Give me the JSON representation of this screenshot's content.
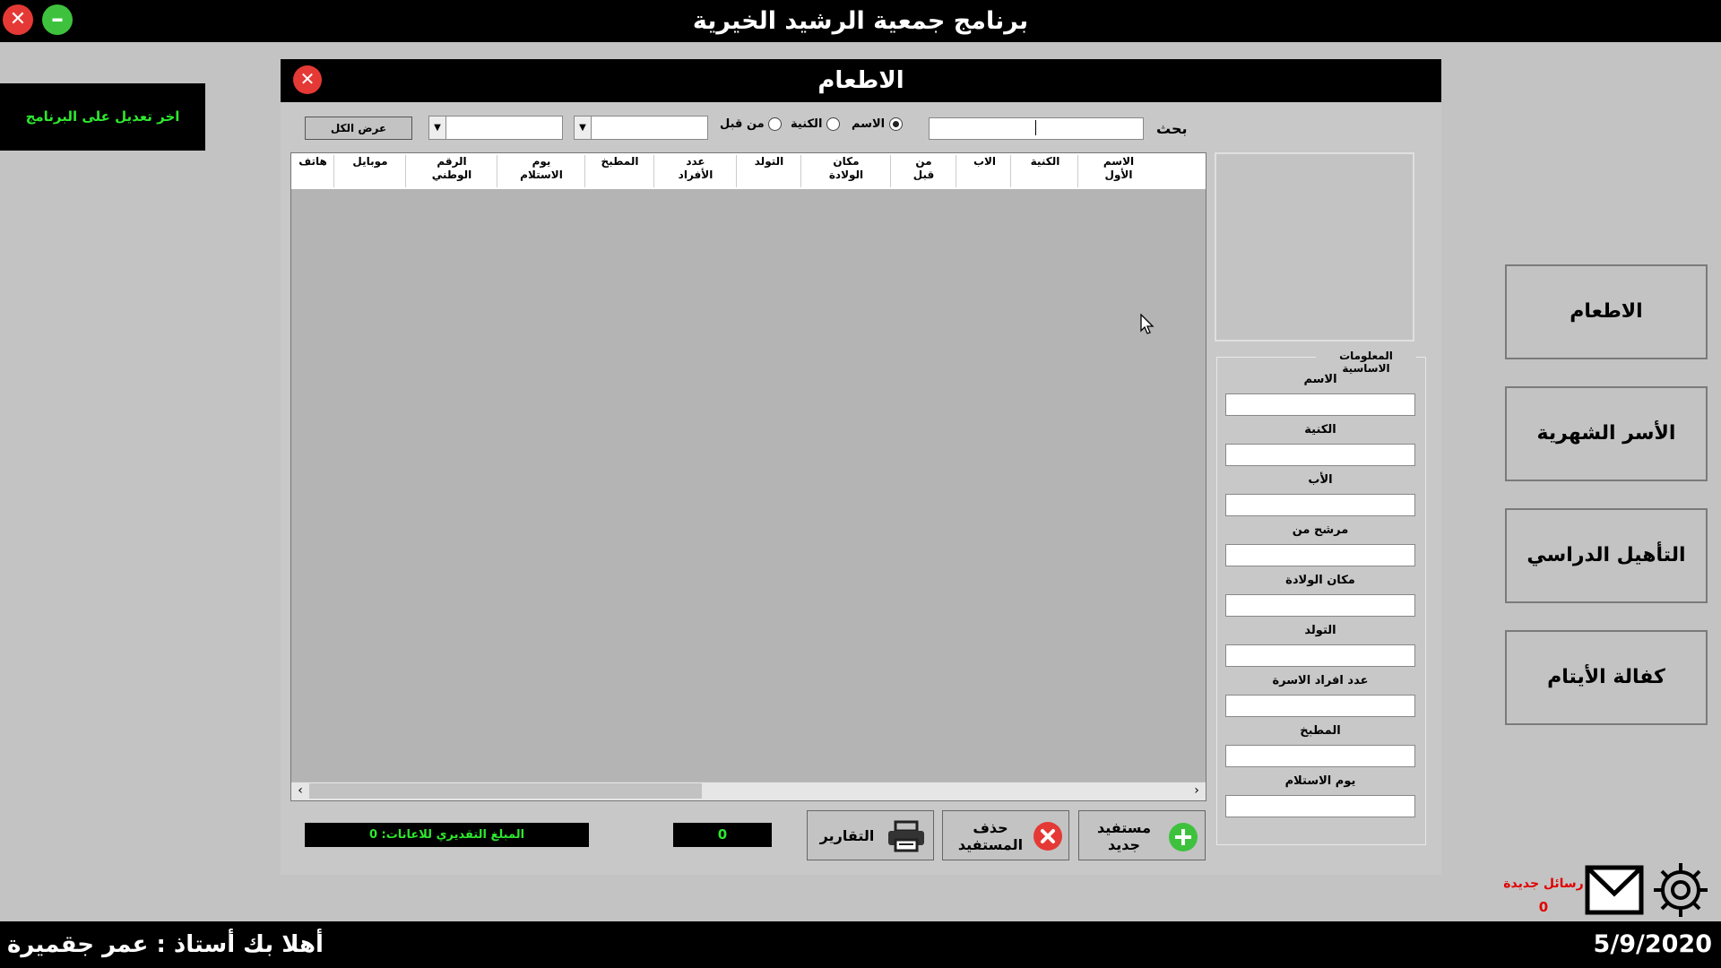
{
  "app": {
    "title": "برنامج جمعية الرشيد الخيرية",
    "close_glyph": "✕",
    "minimize_glyph": "–"
  },
  "left_note": "اخر تعديل على البرنامج",
  "side_menu": [
    {
      "label": "الاطعام"
    },
    {
      "label": "الأسر الشهرية"
    },
    {
      "label": "التأهيل الدراسي"
    },
    {
      "label": "كفالة الأيتام"
    }
  ],
  "status": {
    "welcome": "أهلا بك أستاذ : عمر جقميرة",
    "date": "5/9/2020"
  },
  "messages": {
    "label": "رسائل جديدة",
    "count": "0"
  },
  "dialog": {
    "title": "الاطعام",
    "close_glyph": "✕",
    "search": {
      "label": "بحث",
      "value": "",
      "options": [
        {
          "label": "الاسم",
          "selected": true
        },
        {
          "label": "الكنية",
          "selected": false
        },
        {
          "label": "من قبل",
          "selected": false
        }
      ],
      "combo1_value": "",
      "combo2_value": "",
      "show_all_label": "عرض الكل"
    },
    "table": {
      "columns": [
        [
          "الاسم",
          "الأول"
        ],
        [
          "الكنية",
          ""
        ],
        [
          "الاب",
          ""
        ],
        [
          "من",
          "قبل"
        ],
        [
          "مكان",
          "الولادة"
        ],
        [
          "التولد",
          ""
        ],
        [
          "عدد",
          "الأفراد"
        ],
        [
          "المطبخ",
          ""
        ],
        [
          "يوم",
          "الاستلام"
        ],
        [
          "الرقم",
          "الوطني"
        ],
        [
          "موبايل",
          ""
        ],
        [
          "هاتف",
          ""
        ]
      ],
      "rows": []
    },
    "info": {
      "legend": "المعلومات الاساسية",
      "fields": [
        {
          "label": "الاسم",
          "value": ""
        },
        {
          "label": "الكنية",
          "value": ""
        },
        {
          "label": "الأب",
          "value": ""
        },
        {
          "label": "مرشح من",
          "value": ""
        },
        {
          "label": "مكان الولادة",
          "value": ""
        },
        {
          "label": "التولد",
          "value": ""
        },
        {
          "label": "عدد افراد الاسرة",
          "value": ""
        },
        {
          "label": "المطبخ",
          "value": ""
        },
        {
          "label": "يوم الاستلام",
          "value": ""
        }
      ]
    },
    "actions": {
      "new": [
        "مستفيد",
        "جديد"
      ],
      "delete": [
        "حذف",
        "المستفيد"
      ],
      "reports": "التقارير"
    },
    "count": "0",
    "total": "المبلغ التقديري للاعانات: 0"
  },
  "colors": {
    "close_red": "#e53935",
    "minimize_green": "#3ec23e",
    "accent_green": "#2ee82e",
    "alert_red": "#e00000"
  }
}
